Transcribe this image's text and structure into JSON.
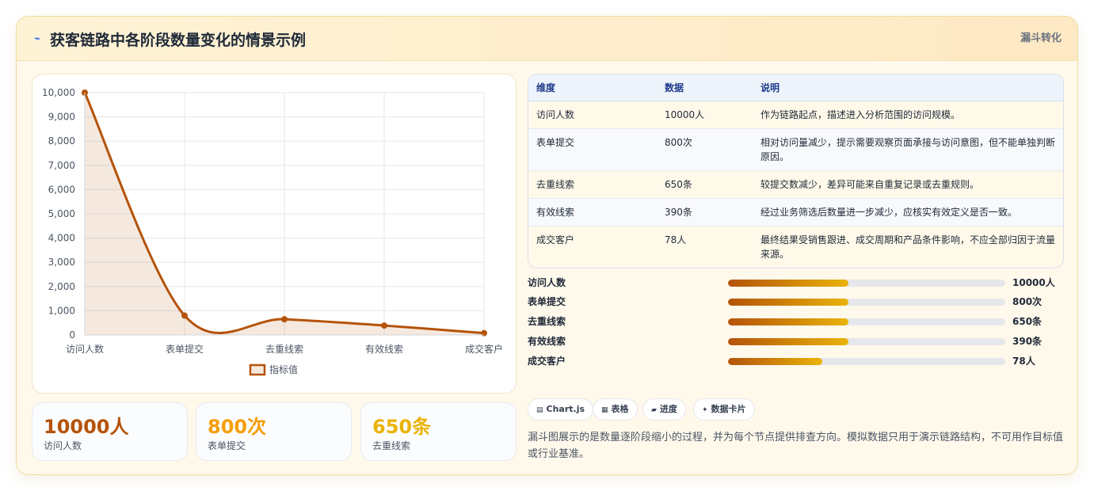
{
  "header": {
    "title": "获客链路中各阶段数量变化的情景示例",
    "tag": "漏斗转化",
    "icon": "chart-icon"
  },
  "chart_data": {
    "type": "line",
    "categories": [
      "访问人数",
      "表单提交",
      "去重线索",
      "有效线索",
      "成交客户"
    ],
    "series": [
      {
        "name": "指标值",
        "values": [
          10000,
          800,
          650,
          390,
          78
        ]
      }
    ],
    "yticks": [
      "0",
      "1,000",
      "2,000",
      "3,000",
      "4,000",
      "5,000",
      "6,000",
      "7,000",
      "8,000",
      "9,000",
      "10,000"
    ],
    "ylim": [
      0,
      10000
    ],
    "grid": true,
    "legend": "bottom",
    "fill": true,
    "color": "#b45309"
  },
  "stats": [
    {
      "value": "10000人",
      "label": "访问人数",
      "color": "#b45309"
    },
    {
      "value": "800次",
      "label": "表单提交",
      "color": "#f59e0b"
    },
    {
      "value": "650条",
      "label": "去重线索",
      "color": "#eab308"
    }
  ],
  "table": {
    "headers": [
      "维度",
      "数据",
      "说明"
    ],
    "rows": [
      {
        "dim": "访问人数",
        "data": "10000人",
        "desc": "作为链路起点，描述进入分析范围的访问规模。"
      },
      {
        "dim": "表单提交",
        "data": "800次",
        "desc": "相对访问量减少，提示需要观察页面承接与访问意图，但不能单独判断原因。"
      },
      {
        "dim": "去重线索",
        "data": "650条",
        "desc": "较提交数减少，差异可能来自重复记录或去重规则。"
      },
      {
        "dim": "有效线索",
        "data": "390条",
        "desc": "经过业务筛选后数量进一步减少，应核实有效定义是否一致。"
      },
      {
        "dim": "成交客户",
        "data": "78人",
        "desc": "最终结果受销售跟进、成交周期和产品条件影响，不应全部归因于流量来源。"
      }
    ]
  },
  "progress": [
    {
      "label": "访问人数",
      "value": "10000人",
      "level": 0.435
    },
    {
      "label": "表单提交",
      "value": "800次",
      "level": 0.435
    },
    {
      "label": "去重线索",
      "value": "650条",
      "level": 0.435
    },
    {
      "label": "有效线索",
      "value": "390条",
      "level": 0.435
    },
    {
      "label": "成交客户",
      "value": "78人",
      "level": 0.34
    }
  ],
  "chips": [
    {
      "icon": "▤",
      "label": "Chart.js"
    },
    {
      "icon": "▦",
      "label": "表格"
    },
    {
      "icon": "▰",
      "label": "进度"
    },
    {
      "icon": "✦",
      "label": "数据卡片"
    }
  ],
  "footnote": "漏斗图展示的是数量逐阶段缩小的过程，并为每个节点提供排查方向。模拟数据只用于演示链路结构，不可用作目标值或行业基准。"
}
